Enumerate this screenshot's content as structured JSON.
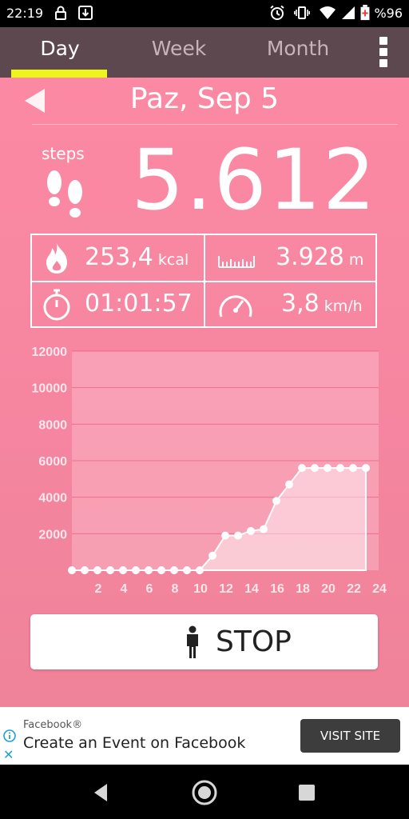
{
  "status_bar": {
    "time": "22:19",
    "battery_text": "%96",
    "icons": [
      "lock-icon",
      "download-icon",
      "alarm-icon",
      "vibrate-icon",
      "wifi-icon",
      "signal-icon",
      "battery-icon"
    ]
  },
  "tabs": {
    "day": "Day",
    "week": "Week",
    "month": "Month",
    "active": "day",
    "accent": "#eef51a"
  },
  "date": {
    "label": "Paz, Sep 5"
  },
  "steps": {
    "label": "steps",
    "value": "5.612"
  },
  "stats": {
    "calories": {
      "value": "253,4",
      "unit": "kcal"
    },
    "distance": {
      "value": "3.928",
      "unit": "m"
    },
    "duration": {
      "value": "01:01:57"
    },
    "speed": {
      "value": "3,8",
      "unit": "km/h"
    }
  },
  "chart_data": {
    "type": "area",
    "x": [
      0,
      1,
      2,
      3,
      4,
      5,
      6,
      7,
      8,
      9,
      10,
      11,
      12,
      13,
      14,
      15,
      16,
      17,
      18,
      19,
      20,
      21,
      22,
      23
    ],
    "values": [
      0,
      0,
      0,
      0,
      0,
      0,
      0,
      0,
      0,
      0,
      0,
      800,
      1900,
      1900,
      2150,
      2250,
      3800,
      4700,
      5600,
      5600,
      5600,
      5600,
      5600,
      5600
    ],
    "xticks": [
      2,
      4,
      6,
      8,
      10,
      12,
      14,
      16,
      18,
      20,
      22,
      24
    ],
    "yticks": [
      2000,
      4000,
      6000,
      8000,
      10000,
      12000
    ],
    "ylim": [
      0,
      12000
    ],
    "xlim": [
      0,
      24
    ]
  },
  "stop_button": {
    "label": "STOP"
  },
  "ad": {
    "source": "Facebook®",
    "title": "Create an Event on Facebook",
    "button": "VISIT SITE"
  },
  "colors": {
    "background": "#fd8aa4",
    "tab_bar": "#5e4850"
  }
}
